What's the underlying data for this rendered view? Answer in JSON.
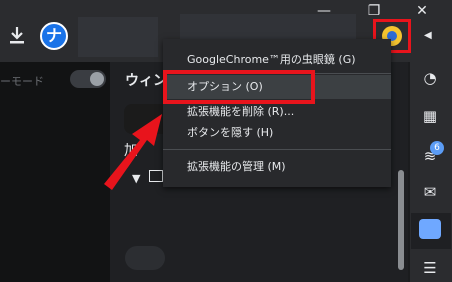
{
  "toolbar": {
    "download_icon": "download-icon",
    "logo_glyph": "ナ",
    "extension_icon": "magnifier-extension-icon"
  },
  "window_controls": {
    "minimize": "—",
    "restore": "❐",
    "close": "✕"
  },
  "left_panel": {
    "mode_text": "ーモード"
  },
  "main_panel": {
    "window_label": "ウィン",
    "kana": "加"
  },
  "context_menu": {
    "items": [
      {
        "label": "GoogleChrome™用の虫眼鏡 (G)"
      },
      {
        "label": "オプション (O)"
      },
      {
        "label": "拡張機能を削除 (R)..."
      },
      {
        "label": "ボタンを隠す (H)"
      },
      {
        "label": "拡張機能の管理 (M)"
      }
    ]
  },
  "sidebar": {
    "badge_count": "6",
    "icons": [
      "history-icon",
      "calendar-icon",
      "feed-icon",
      "mail-icon",
      "card-icon",
      "notes-icon"
    ]
  },
  "colors": {
    "highlight": "#e8141c",
    "accent": "#6fa8ff",
    "badge": "#5b9cf5"
  }
}
